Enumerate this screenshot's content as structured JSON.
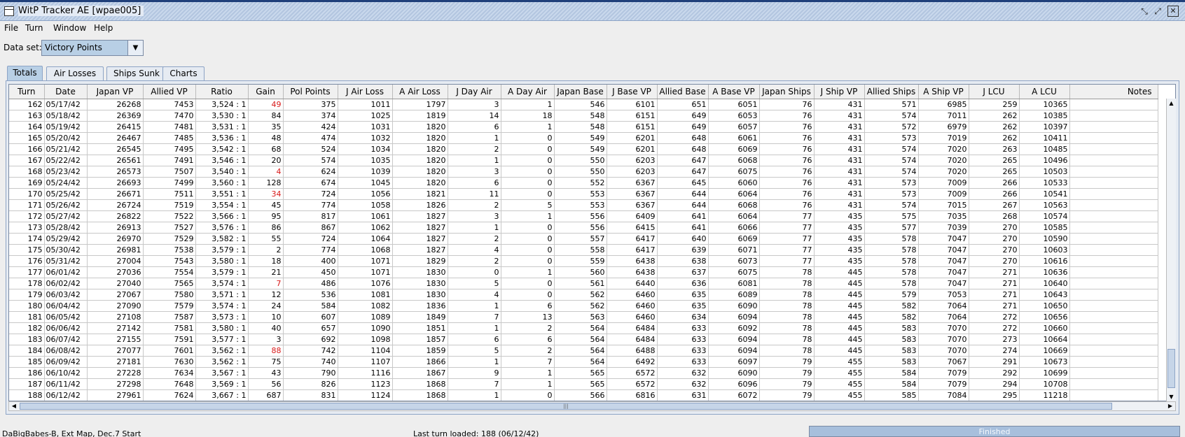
{
  "window": {
    "title": "WitP Tracker AE [wpae005]",
    "controls": [
      "⤡",
      "⤢",
      "✕"
    ]
  },
  "menu": [
    "File",
    "Turn",
    "Window",
    "Help"
  ],
  "dataset": {
    "label": "Data set:",
    "value": "Victory Points"
  },
  "tabs": [
    "Totals",
    "Air Losses",
    "Ships Sunk",
    "Charts"
  ],
  "table": {
    "columns": [
      "Turn",
      "Date",
      "Japan VP",
      "Allied VP",
      "Ratio",
      "Gain",
      "Pol Points",
      "J Air Loss",
      "A Air Loss",
      "J Day Air",
      "A Day Air",
      "Japan Base",
      "J Base VP",
      "Allied Base",
      "A Base VP",
      "Japan Ships",
      "J Ship VP",
      "Allied Ships",
      "A Ship VP",
      "J LCU",
      "A LCU",
      "Notes"
    ],
    "red_gain_turns": [
      162,
      168,
      170,
      178,
      184
    ],
    "rows": [
      [
        "162",
        "05/17/42",
        "26268",
        "7453",
        "3,524 : 1",
        "49",
        "375",
        "1011",
        "1797",
        "3",
        "1",
        "546",
        "6101",
        "651",
        "6051",
        "76",
        "431",
        "571",
        "6985",
        "259",
        "10365",
        ""
      ],
      [
        "163",
        "05/18/42",
        "26369",
        "7470",
        "3,530 : 1",
        "84",
        "374",
        "1025",
        "1819",
        "14",
        "18",
        "548",
        "6151",
        "649",
        "6053",
        "76",
        "431",
        "574",
        "7011",
        "262",
        "10385",
        ""
      ],
      [
        "164",
        "05/19/42",
        "26415",
        "7481",
        "3,531 : 1",
        "35",
        "424",
        "1031",
        "1820",
        "6",
        "1",
        "548",
        "6151",
        "649",
        "6057",
        "76",
        "431",
        "572",
        "6979",
        "262",
        "10397",
        ""
      ],
      [
        "165",
        "05/20/42",
        "26467",
        "7485",
        "3,536 : 1",
        "48",
        "474",
        "1032",
        "1820",
        "1",
        "0",
        "549",
        "6201",
        "648",
        "6061",
        "76",
        "431",
        "573",
        "7019",
        "262",
        "10411",
        ""
      ],
      [
        "166",
        "05/21/42",
        "26545",
        "7495",
        "3,542 : 1",
        "68",
        "524",
        "1034",
        "1820",
        "2",
        "0",
        "549",
        "6201",
        "648",
        "6069",
        "76",
        "431",
        "574",
        "7020",
        "263",
        "10485",
        ""
      ],
      [
        "167",
        "05/22/42",
        "26561",
        "7491",
        "3,546 : 1",
        "20",
        "574",
        "1035",
        "1820",
        "1",
        "0",
        "550",
        "6203",
        "647",
        "6068",
        "76",
        "431",
        "574",
        "7020",
        "265",
        "10496",
        ""
      ],
      [
        "168",
        "05/23/42",
        "26573",
        "7507",
        "3,540 : 1",
        "4",
        "624",
        "1039",
        "1820",
        "3",
        "0",
        "550",
        "6203",
        "647",
        "6075",
        "76",
        "431",
        "574",
        "7020",
        "265",
        "10503",
        ""
      ],
      [
        "169",
        "05/24/42",
        "26693",
        "7499",
        "3,560 : 1",
        "128",
        "674",
        "1045",
        "1820",
        "6",
        "0",
        "552",
        "6367",
        "645",
        "6060",
        "76",
        "431",
        "573",
        "7009",
        "266",
        "10533",
        ""
      ],
      [
        "170",
        "05/25/42",
        "26671",
        "7511",
        "3,551 : 1",
        "34",
        "724",
        "1056",
        "1821",
        "11",
        "0",
        "553",
        "6367",
        "644",
        "6064",
        "76",
        "431",
        "573",
        "7009",
        "266",
        "10541",
        ""
      ],
      [
        "171",
        "05/26/42",
        "26724",
        "7519",
        "3,554 : 1",
        "45",
        "774",
        "1058",
        "1826",
        "2",
        "5",
        "553",
        "6367",
        "644",
        "6068",
        "76",
        "431",
        "574",
        "7015",
        "267",
        "10563",
        ""
      ],
      [
        "172",
        "05/27/42",
        "26822",
        "7522",
        "3,566 : 1",
        "95",
        "817",
        "1061",
        "1827",
        "3",
        "1",
        "556",
        "6409",
        "641",
        "6064",
        "77",
        "435",
        "575",
        "7035",
        "268",
        "10574",
        ""
      ],
      [
        "173",
        "05/28/42",
        "26913",
        "7527",
        "3,576 : 1",
        "86",
        "867",
        "1062",
        "1827",
        "1",
        "0",
        "556",
        "6415",
        "641",
        "6066",
        "77",
        "435",
        "577",
        "7039",
        "270",
        "10585",
        ""
      ],
      [
        "174",
        "05/29/42",
        "26970",
        "7529",
        "3,582 : 1",
        "55",
        "724",
        "1064",
        "1827",
        "2",
        "0",
        "557",
        "6417",
        "640",
        "6069",
        "77",
        "435",
        "578",
        "7047",
        "270",
        "10590",
        ""
      ],
      [
        "175",
        "05/30/42",
        "26981",
        "7538",
        "3,579 : 1",
        "2",
        "774",
        "1068",
        "1827",
        "4",
        "0",
        "558",
        "6417",
        "639",
        "6071",
        "77",
        "435",
        "578",
        "7047",
        "270",
        "10603",
        ""
      ],
      [
        "176",
        "05/31/42",
        "27004",
        "7543",
        "3,580 : 1",
        "18",
        "400",
        "1071",
        "1829",
        "2",
        "0",
        "559",
        "6438",
        "638",
        "6073",
        "77",
        "435",
        "578",
        "7047",
        "270",
        "10616",
        ""
      ],
      [
        "177",
        "06/01/42",
        "27036",
        "7554",
        "3,579 : 1",
        "21",
        "450",
        "1071",
        "1830",
        "0",
        "1",
        "560",
        "6438",
        "637",
        "6075",
        "78",
        "445",
        "578",
        "7047",
        "271",
        "10636",
        ""
      ],
      [
        "178",
        "06/02/42",
        "27040",
        "7565",
        "3,574 : 1",
        "7",
        "486",
        "1076",
        "1830",
        "5",
        "0",
        "561",
        "6440",
        "636",
        "6081",
        "78",
        "445",
        "578",
        "7047",
        "271",
        "10640",
        ""
      ],
      [
        "179",
        "06/03/42",
        "27067",
        "7580",
        "3,571 : 1",
        "12",
        "536",
        "1081",
        "1830",
        "4",
        "0",
        "562",
        "6460",
        "635",
        "6089",
        "78",
        "445",
        "579",
        "7053",
        "271",
        "10643",
        ""
      ],
      [
        "180",
        "06/04/42",
        "27090",
        "7579",
        "3,574 : 1",
        "24",
        "584",
        "1082",
        "1836",
        "1",
        "6",
        "562",
        "6460",
        "635",
        "6090",
        "78",
        "445",
        "582",
        "7064",
        "271",
        "10650",
        ""
      ],
      [
        "181",
        "06/05/42",
        "27108",
        "7587",
        "3,573 : 1",
        "10",
        "607",
        "1089",
        "1849",
        "7",
        "13",
        "563",
        "6460",
        "634",
        "6094",
        "78",
        "445",
        "582",
        "7064",
        "272",
        "10656",
        ""
      ],
      [
        "182",
        "06/06/42",
        "27142",
        "7581",
        "3,580 : 1",
        "40",
        "657",
        "1090",
        "1851",
        "1",
        "2",
        "564",
        "6484",
        "633",
        "6092",
        "78",
        "445",
        "583",
        "7070",
        "272",
        "10660",
        ""
      ],
      [
        "183",
        "06/07/42",
        "27155",
        "7591",
        "3,577 : 1",
        "3",
        "692",
        "1098",
        "1857",
        "6",
        "6",
        "564",
        "6484",
        "633",
        "6094",
        "78",
        "445",
        "583",
        "7070",
        "273",
        "10664",
        ""
      ],
      [
        "184",
        "06/08/42",
        "27077",
        "7601",
        "3,562 : 1",
        "88",
        "742",
        "1104",
        "1859",
        "5",
        "2",
        "564",
        "6488",
        "633",
        "6094",
        "78",
        "445",
        "583",
        "7070",
        "274",
        "10669",
        ""
      ],
      [
        "185",
        "06/09/42",
        "27181",
        "7630",
        "3,562 : 1",
        "75",
        "740",
        "1107",
        "1866",
        "1",
        "7",
        "564",
        "6492",
        "633",
        "6097",
        "79",
        "455",
        "583",
        "7067",
        "291",
        "10673",
        ""
      ],
      [
        "186",
        "06/10/42",
        "27228",
        "7634",
        "3,567 : 1",
        "43",
        "790",
        "1116",
        "1867",
        "9",
        "1",
        "565",
        "6572",
        "632",
        "6090",
        "79",
        "455",
        "584",
        "7079",
        "292",
        "10699",
        ""
      ],
      [
        "187",
        "06/11/42",
        "27298",
        "7648",
        "3,569 : 1",
        "56",
        "826",
        "1123",
        "1868",
        "7",
        "1",
        "565",
        "6572",
        "632",
        "6096",
        "79",
        "455",
        "584",
        "7079",
        "294",
        "10708",
        ""
      ],
      [
        "188",
        "06/12/42",
        "27961",
        "7624",
        "3,667 : 1",
        "687",
        "831",
        "1124",
        "1868",
        "1",
        "0",
        "566",
        "6816",
        "631",
        "6072",
        "79",
        "455",
        "585",
        "7084",
        "295",
        "11218",
        ""
      ]
    ]
  },
  "status": {
    "scenario": "DaBigBabes-B, Ext Map, Dec.7 Start",
    "last_turn": "Last turn loaded: 188 (06/12/42)",
    "progress_label": "Finished",
    "progress_percent": 100
  }
}
